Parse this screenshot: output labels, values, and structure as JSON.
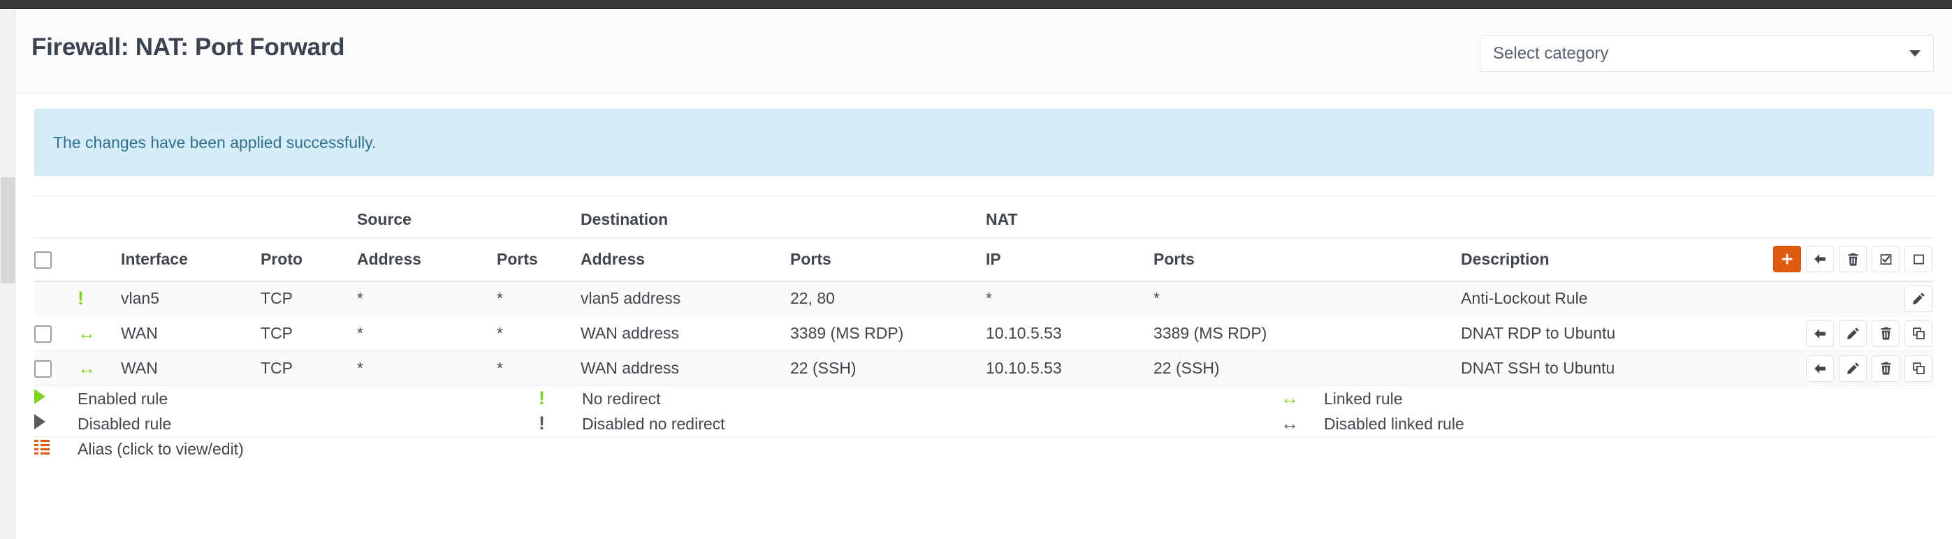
{
  "window": {
    "title": "Firewall: NAT: Port Forward"
  },
  "header": {
    "title": "Firewall: NAT: Port Forward",
    "category_select": {
      "value": "Select category",
      "placeholder": "Select category",
      "caret_icon": "chevron-down-icon"
    }
  },
  "alert": {
    "message": "The changes have been applied successfully.",
    "type": "info",
    "bg_color": "#d4edf7",
    "text_color": "#31708f"
  },
  "colors": {
    "accent_orange": "#e05a10",
    "enabled_green": "#7ed321",
    "disabled_grey": "#5b5b5b",
    "info_blue_bg": "#d4edf7",
    "text": "#41464c"
  },
  "table": {
    "group_headers": {
      "source": "Source",
      "destination": "Destination",
      "nat": "NAT"
    },
    "columns": {
      "interface": "Interface",
      "proto": "Proto",
      "source_address": "Address",
      "source_ports": "Ports",
      "dest_address": "Address",
      "dest_ports": "Ports",
      "nat_ip": "IP",
      "nat_ports": "Ports",
      "description": "Description"
    },
    "header_actions": [
      {
        "name": "add-rule-bottom-button",
        "icon": "plus-icon",
        "style": "primary"
      },
      {
        "name": "add-rule-top-button",
        "icon": "arrow-left-icon",
        "style": "default"
      },
      {
        "name": "delete-selected-button",
        "icon": "trash-icon",
        "style": "default"
      },
      {
        "name": "toggle-selected-button",
        "icon": "checked-box-icon",
        "style": "default"
      },
      {
        "name": "select-all-button",
        "icon": "empty-box-icon",
        "style": "default"
      }
    ],
    "rows": [
      {
        "selectable": false,
        "checked": false,
        "status_icon": "no-redirect-icon",
        "status_state": "enabled",
        "interface": "vlan5",
        "proto": "TCP",
        "source_address": "*",
        "source_ports": "*",
        "dest_address": "vlan5 address",
        "dest_ports": "22, 80",
        "nat_ip": "*",
        "nat_ports": "*",
        "description": "Anti-Lockout Rule",
        "striped": true,
        "actions": [
          {
            "name": "edit-rule-button",
            "icon": "pencil-icon"
          }
        ]
      },
      {
        "selectable": true,
        "checked": false,
        "status_icon": "linked-rule-icon",
        "status_state": "enabled",
        "interface": "WAN",
        "proto": "TCP",
        "source_address": "*",
        "source_ports": "*",
        "dest_address": "WAN address",
        "dest_ports": "3389 (MS RDP)",
        "nat_ip": "10.10.5.53",
        "nat_ports": "3389 (MS RDP)",
        "description": "DNAT RDP to Ubuntu",
        "striped": false,
        "actions": [
          {
            "name": "move-rule-button",
            "icon": "arrow-left-icon"
          },
          {
            "name": "edit-rule-button",
            "icon": "pencil-icon"
          },
          {
            "name": "delete-rule-button",
            "icon": "trash-icon"
          },
          {
            "name": "copy-rule-button",
            "icon": "copy-icon"
          }
        ]
      },
      {
        "selectable": true,
        "checked": false,
        "status_icon": "linked-rule-icon",
        "status_state": "enabled",
        "interface": "WAN",
        "proto": "TCP",
        "source_address": "*",
        "source_ports": "*",
        "dest_address": "WAN address",
        "dest_ports": "22 (SSH)",
        "nat_ip": "10.10.5.53",
        "nat_ports": "22 (SSH)",
        "description": "DNAT SSH to Ubuntu",
        "striped": true,
        "actions": [
          {
            "name": "move-rule-button",
            "icon": "arrow-left-icon"
          },
          {
            "name": "edit-rule-button",
            "icon": "pencil-icon"
          },
          {
            "name": "delete-rule-button",
            "icon": "trash-icon"
          },
          {
            "name": "copy-rule-button",
            "icon": "copy-icon"
          }
        ]
      }
    ]
  },
  "legend": {
    "rows": [
      {
        "icon1": "play-icon",
        "icon1_state": "enabled",
        "label1": "Enabled rule",
        "icon2": "exclamation-icon",
        "icon2_state": "enabled",
        "label2": "No redirect",
        "icon3": "linked-rule-icon",
        "icon3_state": "enabled",
        "label3": "Linked rule"
      },
      {
        "icon1": "play-icon",
        "icon1_state": "disabled",
        "label1": "Disabled rule",
        "icon2": "exclamation-icon",
        "icon2_state": "disabled",
        "label2": "Disabled no redirect",
        "icon3": "linked-rule-icon",
        "icon3_state": "disabled",
        "label3": "Disabled linked rule"
      }
    ],
    "alias": {
      "icon": "alias-list-icon",
      "label": "Alias (click to view/edit)"
    }
  }
}
